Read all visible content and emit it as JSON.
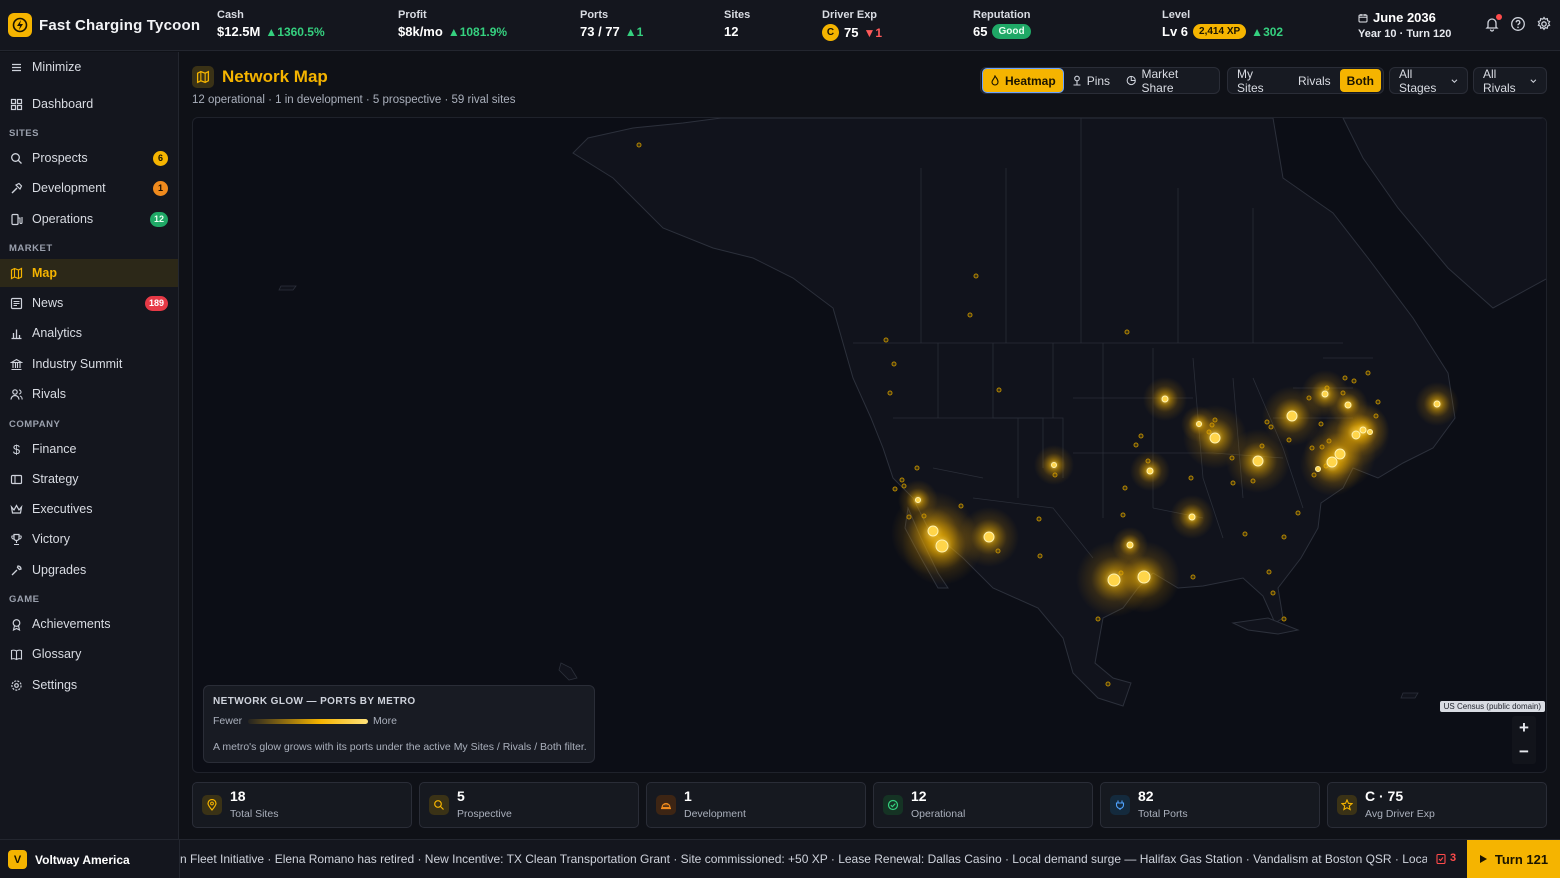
{
  "app": {
    "title": "Fast Charging Tycoon",
    "icon": "lightning-icon"
  },
  "stats": {
    "cash": {
      "label": "Cash",
      "value": "$12.5M",
      "delta": "1360.5%"
    },
    "profit": {
      "label": "Profit",
      "value": "$8k/mo",
      "delta": "1081.9%"
    },
    "ports": {
      "label": "Ports",
      "value": "73 / 77",
      "delta": "1"
    },
    "sites": {
      "label": "Sites",
      "value": "12"
    },
    "driver_exp": {
      "label": "Driver Exp",
      "grade": "C",
      "value": "75",
      "delta": "1"
    },
    "reputation": {
      "label": "Reputation",
      "value": "65",
      "badge": "Good"
    },
    "level": {
      "label": "Level",
      "value": "Lv 6",
      "xp": "2,414 XP",
      "delta": "302"
    }
  },
  "date": {
    "main": "June 2036",
    "sub": "Year 10 · Turn 120"
  },
  "top_icons": [
    "bell-icon",
    "help-icon",
    "gear-icon"
  ],
  "sidebar": {
    "minimize": "Minimize",
    "dashboard": "Dashboard",
    "sections": {
      "sites": "SITES",
      "market": "MARKET",
      "company": "COMPANY",
      "game": "GAME"
    },
    "items": {
      "prospects": {
        "label": "Prospects",
        "badge": "6"
      },
      "development": {
        "label": "Development",
        "badge": "1"
      },
      "operations": {
        "label": "Operations",
        "badge": "12"
      },
      "map": {
        "label": "Map"
      },
      "news": {
        "label": "News",
        "badge": "189"
      },
      "analytics": {
        "label": "Analytics"
      },
      "industry_summit": {
        "label": "Industry Summit"
      },
      "rivals": {
        "label": "Rivals"
      },
      "finance": {
        "label": "Finance"
      },
      "strategy": {
        "label": "Strategy"
      },
      "executives": {
        "label": "Executives"
      },
      "victory": {
        "label": "Victory"
      },
      "upgrades": {
        "label": "Upgrades"
      },
      "achievements": {
        "label": "Achievements"
      },
      "glossary": {
        "label": "Glossary"
      },
      "settings": {
        "label": "Settings"
      }
    }
  },
  "main": {
    "title": "Network Map",
    "subtitle": "12 operational · 1 in development · 5 prospective · 59 rival sites",
    "view_modes": {
      "heatmap": "Heatmap",
      "pins": "Pins",
      "market_share": "Market Share",
      "selected": "Heatmap"
    },
    "owner_filter": {
      "my_sites": "My Sites",
      "rivals": "Rivals",
      "both": "Both",
      "selected": "Both"
    },
    "stage_filter": "All Stages",
    "rival_filter": "All Rivals"
  },
  "legend": {
    "title": "NETWORK GLOW — PORTS BY METRO",
    "fewer": "Fewer",
    "more": "More",
    "description": "A metro's glow grows with its ports under the active My Sites / Rivals / Both filter."
  },
  "map": {
    "attribution": "US Census (public domain)",
    "zoom_in": "+",
    "zoom_out": "−"
  },
  "cards": [
    {
      "value": "18",
      "label": "Total Sites",
      "icon": "pin-icon",
      "color": "#f5b400"
    },
    {
      "value": "5",
      "label": "Prospective",
      "icon": "search-icon",
      "color": "#f5b400"
    },
    {
      "value": "1",
      "label": "Development",
      "icon": "hardhat-icon",
      "color": "#f08a1d"
    },
    {
      "value": "12",
      "label": "Operational",
      "icon": "check-circle-icon",
      "color": "#35d07f"
    },
    {
      "value": "82",
      "label": "Total Ports",
      "icon": "plug-icon",
      "color": "#4fa3ff"
    },
    {
      "value": "C · 75",
      "label": "Avg Driver Exp",
      "icon": "star-icon",
      "color": "#f5b400"
    }
  ],
  "bottom": {
    "company": "Voltway America",
    "company_logo": "V",
    "ticker": "n Fleet Initiative · Elena Romano has retired · New Incentive: TX Clean Transportation Grant · Site commissioned: +50 XP · Lease Renewal: Dallas Casino · Local demand surge — Halifax Gas Station · Vandalism at Boston QSR · Local demand surge — D",
    "alerts": "3",
    "turn_button": "Turn 121"
  },
  "colors": {
    "accent": "#f5b400",
    "positive": "#35d07f",
    "negative": "#ff5a5a",
    "bg": "#0f1117"
  }
}
